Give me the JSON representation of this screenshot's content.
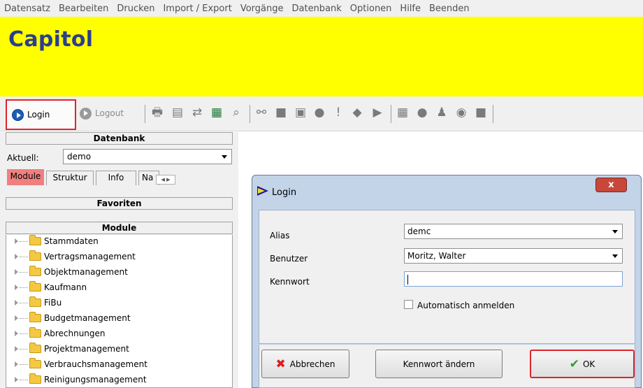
{
  "menu": [
    "Datensatz",
    "Bearbeiten",
    "Drucken",
    "Import / Export",
    "Vorgänge",
    "Datenbank",
    "Optionen",
    "Hilfe",
    "Beenden"
  ],
  "banner": {
    "title": "Capitol",
    "color": "#ffff00",
    "title_color": "#2b3f8c"
  },
  "toolbar": {
    "login_label": "Login",
    "logout_label": "Logout",
    "icons": [
      "print-icon",
      "print-preview-icon",
      "transfer-icon",
      "excel-icon",
      "magnifier-icon",
      "binoculars-icon",
      "folder-icon",
      "document-icon",
      "circle-icon",
      "exclamation-icon",
      "tag-icon",
      "play-icon",
      "calculator-icon",
      "circle-icon",
      "person-icon",
      "check-icon",
      "square-icon"
    ]
  },
  "left_pane": {
    "datenbank_header": "Datenbank",
    "aktuell_label": "Aktuell:",
    "db_value": "demo",
    "tabs": [
      "Module",
      "Struktur",
      "Info",
      "Na"
    ],
    "favoriten_header": "Favoriten",
    "module_header": "Module",
    "tree": [
      "Stammdaten",
      "Vertragsmanagement",
      "Objektmanagement",
      "Kaufmann",
      "FiBu",
      "Budgetmanagement",
      "Abrechnungen",
      "Projektmanagement",
      "Verbrauchsmanagement",
      "Reinigungsmanagement"
    ]
  },
  "dialog": {
    "title": "Login",
    "close_label": "x",
    "alias_label": "Alias",
    "alias_value": "demc",
    "benutzer_label": "Benutzer",
    "benutzer_value": "Moritz, Walter",
    "kennwort_label": "Kennwort",
    "kennwort_value": "",
    "auto_login_label": "Automatisch anmelden",
    "cancel_label": "Abbrechen",
    "change_pw_label": "Kennwort ändern",
    "ok_label": "OK"
  }
}
